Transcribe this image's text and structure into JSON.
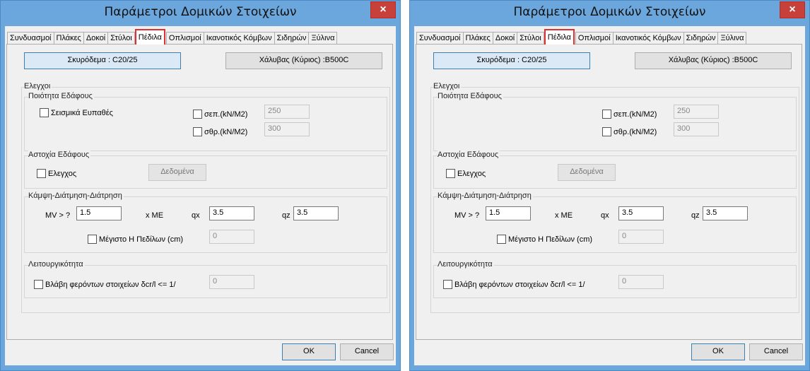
{
  "dialog": {
    "title": "Παράμετροι Δομικών Στοιχείων",
    "close_symbol": "×",
    "tabs": [
      "Συνδυασμοί",
      "Πλάκες",
      "Δοκοί",
      "Στύλοι",
      "Πέδιλα",
      "Οπλισμοί",
      "Ικανοτικός Κόμβων",
      "Σιδηρών",
      "Ξύλινα"
    ],
    "active_tab": "Πέδιλα",
    "concrete_button": "Σκυρόδεμα : C20/25",
    "steel_button": "Χάλυβας (Κύριος) :B500C",
    "checks_group": "Ελεγχοι",
    "soil_quality_group": "Ποιότητα Εδάφους",
    "seismic_sensitive": "Σεισμικά Ευπαθές",
    "sigma_ep_label": "σεπ.(kN/M2)",
    "sigma_ep_value": "250",
    "sigma_thr_label": "σθρ.(kN/M2)",
    "sigma_thr_value": "300",
    "soil_failure_group": "Αστοχία Εδάφους",
    "check_label": "Ελεγχος",
    "data_button": "Δεδομένα",
    "bending_group": "Κάμψη-Διάτμηση-Διάτρηση",
    "mv_label": "MV > ?",
    "mv_value": "1.5",
    "xme_label": "x ME",
    "qx_label": "qx",
    "qx_value": "3.5",
    "qz_label": "qz",
    "qz_value": "3.5",
    "max_h_label": "Μέγιστο Η Πεδίλων (cm)",
    "max_h_value": "0",
    "serviceability_group": "Λειτουργικότητα",
    "damage_label": "Βλάβη φερόντων στοιχείων δcr/l <= 1/",
    "damage_value": "0",
    "ok_button": "OK",
    "cancel_button": "Cancel"
  },
  "colors": {
    "window_frame": "#6ba6dc",
    "close_button": "#c7413a",
    "active_tab_highlight": "#e03030"
  }
}
